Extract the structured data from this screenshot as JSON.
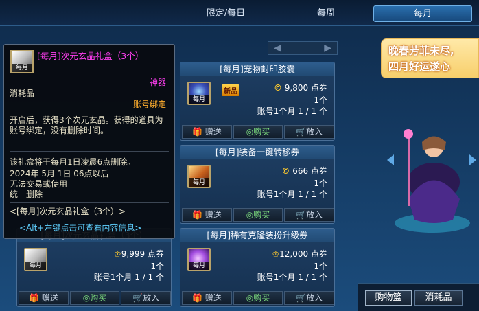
{
  "tabs": [
    "限定/每日",
    "每周",
    "每月"
  ],
  "active_tab": "每月",
  "banner": {
    "line1": "晚春芳菲未尽,",
    "line2": "四月好运遂心"
  },
  "icon_tag": "每月",
  "cards": [
    {
      "title": "[每月]宠物封印胶囊",
      "badge": "新品",
      "price_value": "9,800",
      "price_unit": "点券",
      "qty": "1个",
      "limit": "账号1个月 1 / 1 个",
      "buttons": {
        "gift": "赠送",
        "buy": "购买",
        "put": "放入"
      }
    },
    {
      "title": "[每月]装备一键转移券",
      "price_value": "666",
      "price_unit": "点券",
      "qty": "1个",
      "limit": "账号1个月 1 / 1 个",
      "buttons": {
        "gift": "赠送",
        "buy": "购买",
        "put": "放入"
      }
    },
    {
      "title": "[每月]稀有克隆装扮升级券",
      "price_value": "12,000",
      "price_unit": "点券",
      "qty": "1个",
      "limit": "账号1个月 1 / 1 个",
      "buttons": {
        "gift": "赠送",
        "buy": "购买",
        "put": "放入"
      }
    },
    {
      "title": "[每月]次元玄晶礼盒（3个）",
      "price_value": "9,999",
      "price_unit": "点券",
      "qty": "1个",
      "limit": "账号1个月 1 / 1 个",
      "buttons": {
        "gift": "赠送",
        "buy": "购买",
        "put": "放入"
      }
    }
  ],
  "tooltip": {
    "title": "[每月]次元玄晶礼盒（3个）",
    "tag": "每月",
    "category": "消耗品",
    "rarity": "神器",
    "bind": "账号绑定",
    "desc": "开启后，获得3个次元玄晶。获得的道具为账号绑定，没有删除时间。",
    "delete_note": "该礼盒将于每月1日凌晨6点删除。",
    "trade_note": "2024年 5月 1日 06点以后\n无法交易或使用\n统一删除",
    "footer_name": "<[每月]次元玄晶礼盒（3个）>",
    "hint": "<Alt+左键点击可查看内容信息>",
    "colors": {
      "title": "#ff3ef0",
      "rarity": "#ff3ef0",
      "bind": "#ffae2e",
      "hint": "#5fd0ff"
    }
  },
  "cart_tabs": [
    "购物篮",
    "消耗品"
  ]
}
